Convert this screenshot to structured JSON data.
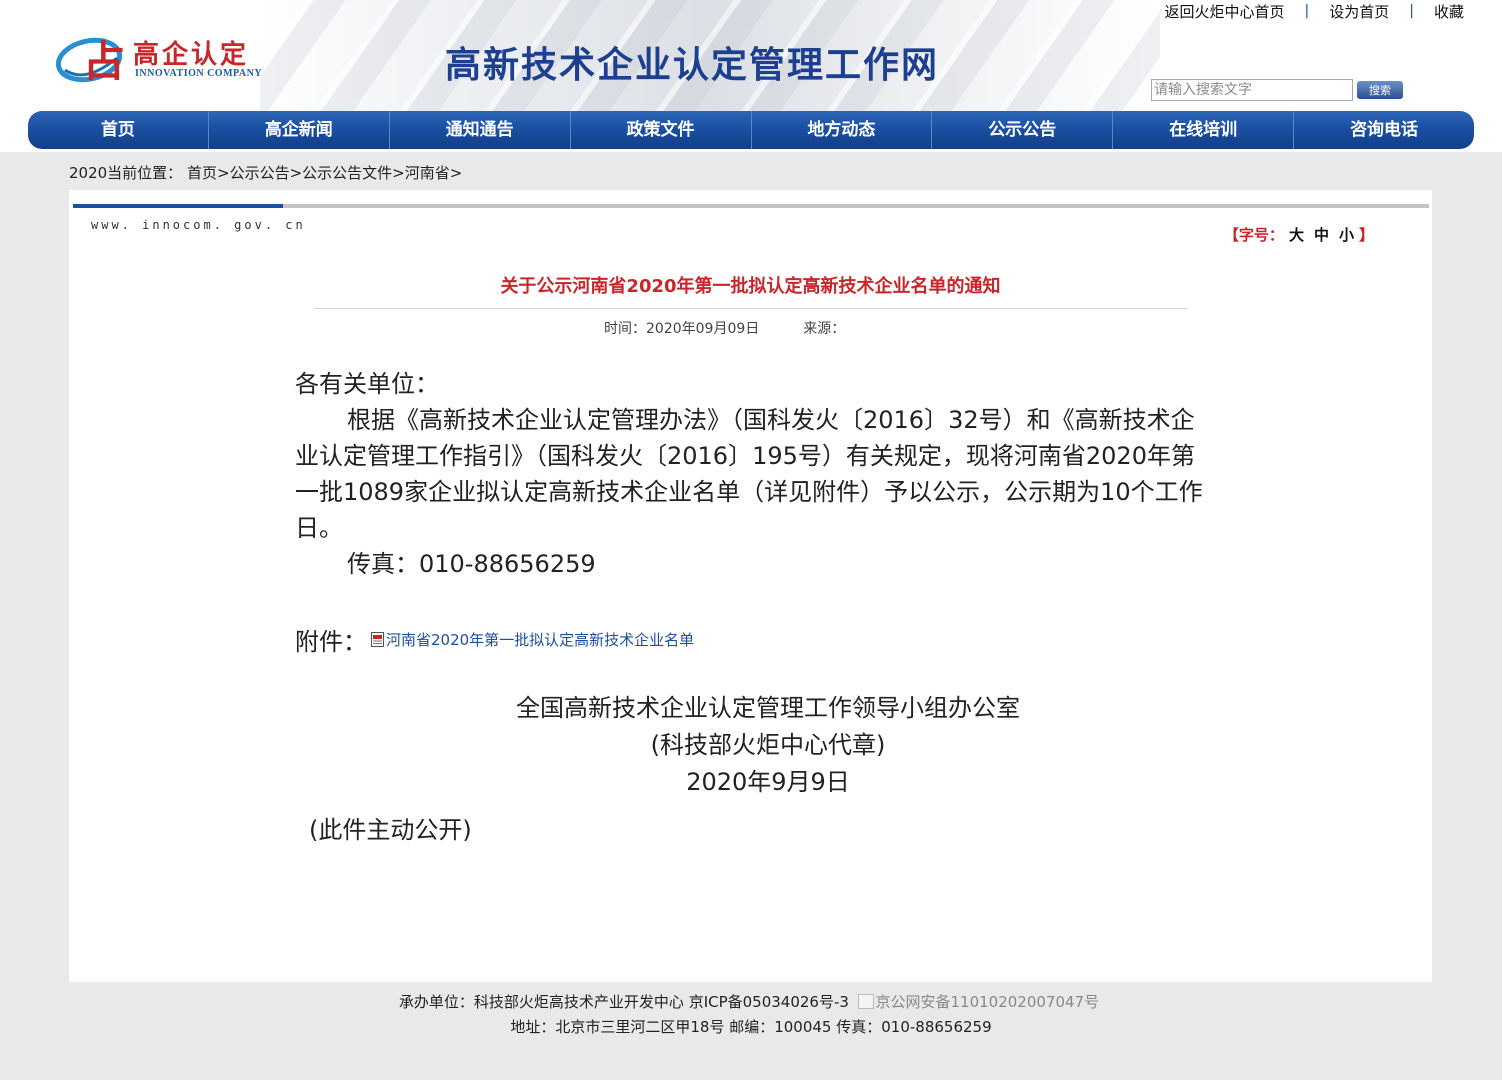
{
  "header": {
    "logo_cn": "高企认定",
    "logo_en": "INNOVATION COMPANY",
    "site_title": "高新技术企业认定管理工作网",
    "top_links": [
      "返回火炬中心首页",
      "设为首页",
      "收藏"
    ],
    "search_placeholder": "请输入搜索文字",
    "search_button": "搜索"
  },
  "nav": {
    "items": [
      "首页",
      "高企新闻",
      "通知通告",
      "政策文件",
      "地方动态",
      "公示公告",
      "在线培训",
      "咨询电话"
    ]
  },
  "breadcrumb": {
    "prefix": "2020当前位置：",
    "items": [
      "首页",
      "公示公告",
      "公示公告文件",
      "河南省"
    ]
  },
  "article": {
    "site_url": "www. innocom. gov. cn",
    "font_size_label": "【字号：",
    "font_size_options": [
      "大",
      "中",
      "小"
    ],
    "font_size_end": "】",
    "title": "关于公示河南省2020年第一批拟认定高新技术企业名单的通知",
    "time_label": "时间：",
    "time_value": "2020年09月09日",
    "source_label": "来源：",
    "salutation": "各有关单位：",
    "paragraph": "根据《高新技术企业认定管理办法》（国科发火〔2016〕32号）和《高新技术企业认定管理工作指引》（国科发火〔2016〕195号）有关规定，现将河南省2020年第一批1089家企业拟认定高新技术企业名单（详见附件）予以公示，公示期为10个工作日。",
    "fax": "传真：010-88656259",
    "attachment_label": "附件：",
    "attachment_link": "河南省2020年第一批拟认定高新技术企业名单",
    "signature_org": "全国高新技术企业认定管理工作领导小组办公室",
    "signature_seal": "(科技部火炬中心代章)",
    "signature_date": "2020年9月9日",
    "disclosure": "(此件主动公开)"
  },
  "footer": {
    "host": "承办单位：科技部火炬高技术产业开发中心",
    "icp": "京ICP备05034026号-3",
    "police": "京公网安备11010202007047号",
    "address": "地址：北京市三里河二区甲18号 邮编：100045 传真：010-88656259"
  },
  "colors": {
    "nav_blue": "#1a4e9f",
    "title_red": "#c8262a",
    "link_blue": "#1d4f9c"
  }
}
